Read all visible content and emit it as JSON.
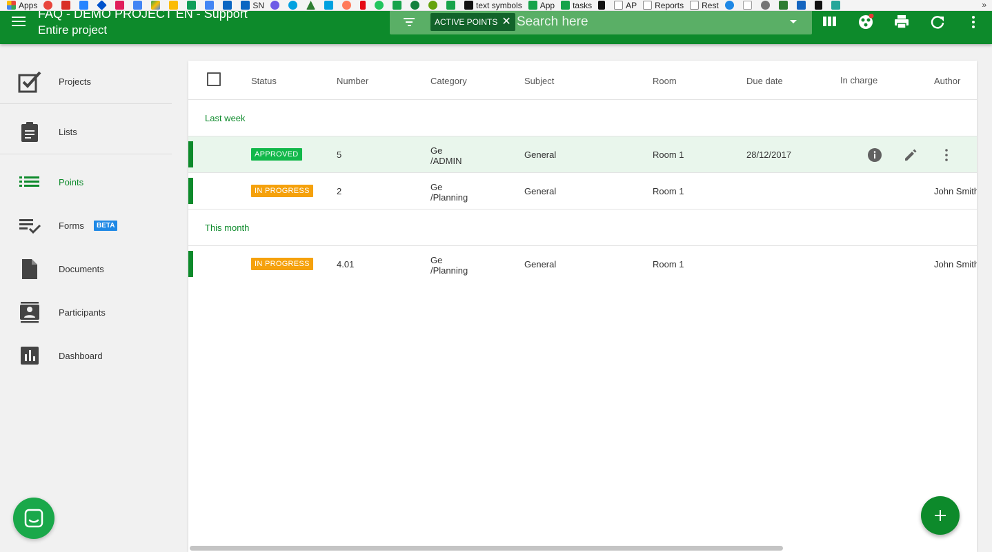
{
  "bookmarks": {
    "items": [
      {
        "label": "Apps",
        "color": "#e8453c"
      },
      {
        "label": "",
        "color": "#e8453c"
      },
      {
        "label": "",
        "color": "#d93025"
      },
      {
        "label": "",
        "color": "#2684ff"
      },
      {
        "label": "",
        "color": "#0052cc"
      },
      {
        "label": "",
        "color": "#e01e5a"
      },
      {
        "label": "",
        "color": "#4285f4"
      },
      {
        "label": "",
        "color": "#34a853"
      },
      {
        "label": "",
        "color": "#fbbc04"
      },
      {
        "label": "",
        "color": "#0f9d58"
      },
      {
        "label": "",
        "color": "#4285f4"
      },
      {
        "label": "",
        "color": "#0a66c2"
      },
      {
        "label": "SN",
        "color": "#0a66c2"
      },
      {
        "label": "",
        "color": "#6e5ce6"
      },
      {
        "label": "",
        "color": "#00a1e0"
      },
      {
        "label": "",
        "color": "#2e7d32"
      },
      {
        "label": "",
        "color": "#00a1e0"
      },
      {
        "label": "",
        "color": "#ff7a59"
      },
      {
        "label": "",
        "color": "#e50914"
      },
      {
        "label": "",
        "color": "#22c55e"
      },
      {
        "label": "",
        "color": "#16a34a"
      },
      {
        "label": "",
        "color": "#15803d"
      },
      {
        "label": "",
        "color": "#65a30d"
      },
      {
        "label": "",
        "color": "#16a34a"
      },
      {
        "label": "text symbols",
        "color": "#111111"
      },
      {
        "label": "App",
        "color": "#16a34a"
      },
      {
        "label": "tasks",
        "color": "#16a34a"
      },
      {
        "label": "",
        "color": "#111111"
      },
      {
        "label": "AP",
        "color": "#888888"
      },
      {
        "label": "Reports",
        "color": "#888888"
      },
      {
        "label": "Rest",
        "color": "#888888"
      },
      {
        "label": "",
        "color": "#1e88e5"
      },
      {
        "label": "",
        "color": "#9e9e9e"
      },
      {
        "label": "",
        "color": "#757575"
      },
      {
        "label": "",
        "color": "#2e7d32"
      },
      {
        "label": "",
        "color": "#1565c0"
      },
      {
        "label": "",
        "color": "#111111"
      },
      {
        "label": "",
        "color": "#26a69a"
      }
    ],
    "more": "»"
  },
  "header": {
    "project_title": "FAQ - DEMO PROJECT EN - Support",
    "scope": "Entire project",
    "chip_label": "ACTIVE POINTS",
    "chip_close": "✕",
    "search_placeholder": "Search here"
  },
  "sidebar": {
    "items": [
      {
        "label": "Projects"
      },
      {
        "label": "Lists"
      },
      {
        "label": "Points"
      },
      {
        "label": "Forms"
      },
      {
        "label": "Documents"
      },
      {
        "label": "Participants"
      },
      {
        "label": "Dashboard"
      }
    ],
    "beta": "BETA"
  },
  "table": {
    "columns": [
      "Status",
      "Number",
      "Category",
      "Subject",
      "Room",
      "Due date",
      "In charge",
      "Author"
    ],
    "groups": [
      {
        "label": "Last week",
        "rows": [
          {
            "status": "APPROVED",
            "status_color": "#12b84a",
            "number": "5",
            "category_1": "Ge",
            "category_2": "/ADMIN",
            "subject": "General",
            "room": "Room 1",
            "due": "28/12/2017",
            "in_charge": "",
            "author": ""
          },
          {
            "status": "IN PROGRESS",
            "status_color": "#f5a10c",
            "number": "2",
            "category_1": "Ge",
            "category_2": "/Planning",
            "subject": "General",
            "room": "Room 1",
            "due": "",
            "in_charge": "",
            "author": "John Smith"
          }
        ]
      },
      {
        "label": "This month",
        "rows": [
          {
            "status": "IN PROGRESS",
            "status_color": "#f5a10c",
            "number": "4.01",
            "category_1": "Ge",
            "category_2": "/Planning",
            "subject": "General",
            "room": "Room 1",
            "due": "",
            "in_charge": "",
            "author": "John Smith"
          }
        ]
      }
    ]
  },
  "colors": {
    "primary": "#0d8a2b",
    "search_bg": "#5aaf66",
    "chip_bg": "#12632a",
    "row_highlight": "#e9f6ec",
    "beta": "#1e88e5",
    "chat": "#1aa84a"
  },
  "icons": {
    "menu": "hamburger-menu-icon",
    "filter": "filter-list-icon",
    "columns": "view-columns-icon",
    "user": "user-avatar-icon",
    "print": "print-icon",
    "refresh": "refresh-icon",
    "more": "more-vertical-icon",
    "info": "info-icon",
    "edit": "pencil-edit-icon",
    "add": "plus-icon",
    "chat": "chat-icon"
  }
}
